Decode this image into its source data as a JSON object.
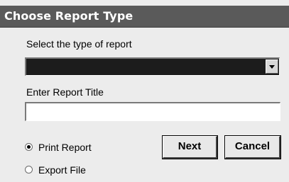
{
  "dialog": {
    "title": "Choose Report Type",
    "report_type_label": "Select the type of report",
    "report_type_value": "",
    "report_title_label": "Enter Report Title",
    "report_title_value": "",
    "radio_options": [
      {
        "label": "Print Report",
        "selected": true
      },
      {
        "label": "Export File",
        "selected": false
      }
    ],
    "next_label": "Next",
    "cancel_label": "Cancel"
  }
}
